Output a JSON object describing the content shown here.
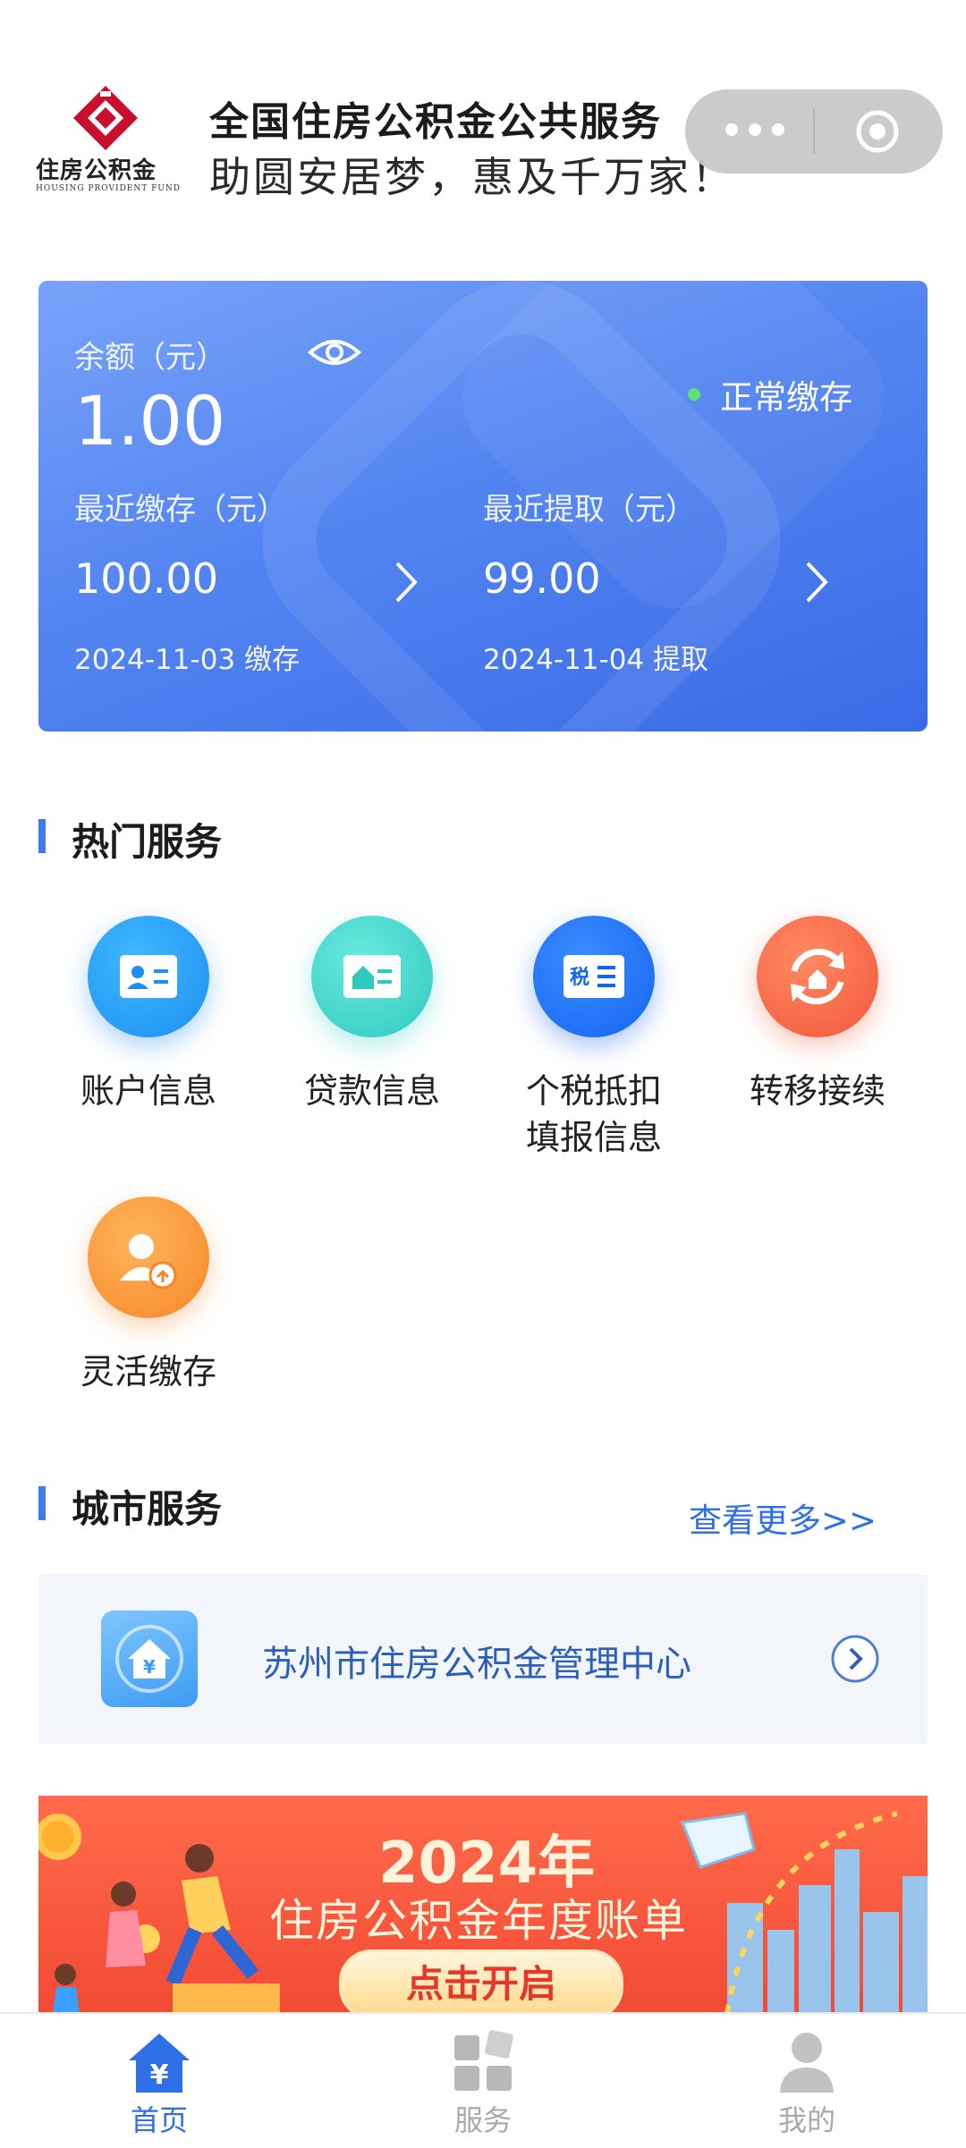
{
  "header": {
    "logo_text": "住房公积金",
    "logo_subtext": "HOUSING PROVIDENT FUND",
    "title": "全国住房公积金公共服务",
    "slogan": "助圆安居梦，惠及千万家！",
    "capsule_icons": [
      "more-dots-icon",
      "record-target-icon"
    ]
  },
  "account_card": {
    "balance_label": "余额（元）",
    "balance": "1.00",
    "eye_icon": "eye-icon",
    "status": "正常缴存",
    "status_color": "#5fe07a",
    "recent_deposit_label": "最近缴存（元）",
    "recent_deposit": "100.00",
    "recent_deposit_date": "2024-11-03 缴存",
    "recent_withdraw_label": "最近提取（元）",
    "recent_withdraw": "99.00",
    "recent_withdraw_date": "2024-11-04 提取",
    "card_gradient": [
      "#79a3f9",
      "#3a6ae6"
    ]
  },
  "hot_services": {
    "title": "热门服务",
    "items": [
      {
        "label": "账户信息",
        "icon": "account-card-icon",
        "color": "#1e8ef0"
      },
      {
        "label": "贷款信息",
        "icon": "loan-house-card-icon",
        "color": "#2fcabf"
      },
      {
        "label_line1": "个税抵扣",
        "label_line2": "填报信息",
        "icon": "tax-card-icon",
        "color": "#1565f0"
      },
      {
        "label": "转移接续",
        "icon": "transfer-cycle-icon",
        "color": "#f2583a"
      },
      {
        "label": "灵活缴存",
        "icon": "flexible-deposit-user-icon",
        "color": "#f7862a"
      }
    ]
  },
  "city_services": {
    "title": "城市服务",
    "more_link": "查看更多>>",
    "center_name": "苏州市住房公积金管理中心",
    "center_icon": "house-yuan-icon"
  },
  "banner": {
    "year": "2024年",
    "subtitle": "住房公积金年度账单",
    "button": "点击开启"
  },
  "tabbar": {
    "items": [
      {
        "label": "首页",
        "icon": "home-yuan-icon",
        "active": true
      },
      {
        "label": "服务",
        "icon": "services-grid-icon",
        "active": false
      },
      {
        "label": "我的",
        "icon": "user-profile-icon",
        "active": false
      }
    ],
    "active_color": "#2f6fe8",
    "idle_color": "#a9a9a9"
  }
}
